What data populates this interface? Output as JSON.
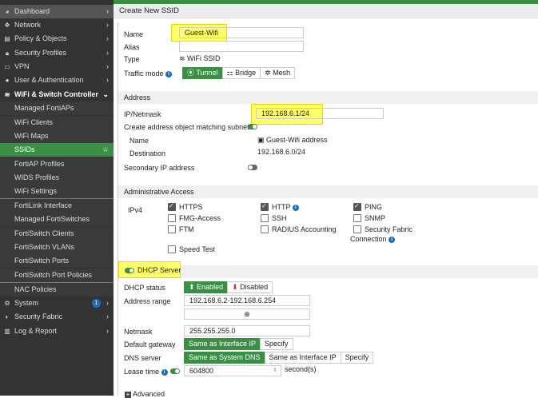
{
  "sidebar": {
    "items": [
      {
        "label": "Dashboard",
        "icon": "dashboard-icon"
      },
      {
        "label": "Network",
        "icon": "network-icon"
      },
      {
        "label": "Policy & Objects",
        "icon": "policy-icon"
      },
      {
        "label": "Security Profiles",
        "icon": "lock-icon"
      },
      {
        "label": "VPN",
        "icon": "laptop-icon"
      },
      {
        "label": "User & Authentication",
        "icon": "user-icon"
      },
      {
        "label": "WiFi & Switch Controller",
        "icon": "wifi-icon"
      },
      {
        "label": "Managed FortiAPs"
      },
      {
        "label": "WiFi Clients"
      },
      {
        "label": "WiFi Maps"
      },
      {
        "label": "SSIDs"
      },
      {
        "label": "FortiAP Profiles"
      },
      {
        "label": "WIDS Profiles"
      },
      {
        "label": "WiFi Settings"
      },
      {
        "label": "FortiLink Interface"
      },
      {
        "label": "Managed FortiSwitches"
      },
      {
        "label": "FortiSwitch Clients"
      },
      {
        "label": "FortiSwitch VLANs"
      },
      {
        "label": "FortiSwitch Ports"
      },
      {
        "label": "FortiSwitch Port Policies"
      },
      {
        "label": "NAC Policies"
      },
      {
        "label": "System",
        "icon": "gear-icon",
        "badge": "1"
      },
      {
        "label": "Security Fabric",
        "icon": "fabric-icon"
      },
      {
        "label": "Log & Report",
        "icon": "chart-icon"
      }
    ]
  },
  "header": {
    "title": "Create New SSID"
  },
  "form": {
    "name_label": "Name",
    "name_value": "Guest-Wifi",
    "alias_label": "Alias",
    "alias_value": "",
    "type_label": "Type",
    "type_value": "WiFi SSID",
    "traffic_label": "Traffic mode",
    "traffic_options": [
      "Tunnel",
      "Bridge",
      "Mesh"
    ]
  },
  "address": {
    "title": "Address",
    "ip_label": "IP/Netmask",
    "ip_value": "192.168.6.1/24",
    "create_label": "Create address object matching subnet",
    "name_label": "Name",
    "name_value": "Guest-Wifi address",
    "dest_label": "Destination",
    "dest_value": "192.168.6.0/24",
    "secondary_label": "Secondary IP address"
  },
  "admin": {
    "title": "Administrative Access",
    "ipv4_label": "IPv4",
    "options": [
      "HTTPS",
      "HTTP",
      "PING",
      "FMG-Access",
      "SSH",
      "SNMP",
      "FTM",
      "RADIUS Accounting",
      "Security Fabric",
      "Speed Test"
    ],
    "connection_label": "Connection"
  },
  "dhcp": {
    "title": "DHCP Server",
    "status_label": "DHCP status",
    "enabled": "Enabled",
    "disabled": "Disabled",
    "range_label": "Address range",
    "range_value": "192.168.6.2-192.168.6.254",
    "netmask_label": "Netmask",
    "netmask_value": "255.255.255.0",
    "gateway_label": "Default gateway",
    "gateway_options": [
      "Same as Interface IP",
      "Specify"
    ],
    "dns_label": "DNS server",
    "dns_options": [
      "Same as System DNS",
      "Same as Interface IP",
      "Specify"
    ],
    "lease_label": "Lease time",
    "lease_value": "604800",
    "lease_unit": "second(s)",
    "advanced_label": "Advanced"
  },
  "colors": {
    "accent": "#3b8f45",
    "sidebar": "#333333",
    "highlight": "#ffff66"
  }
}
